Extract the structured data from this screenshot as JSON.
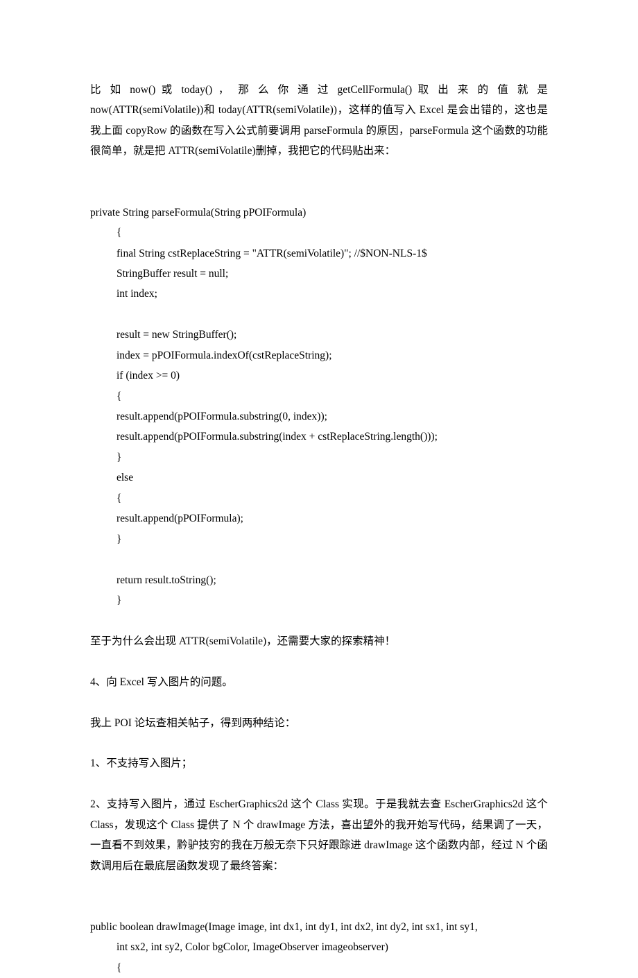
{
  "para_intro_1": "比 如 now()  或 today()  ， 那 么 你 通 过 getCellFormula()  取 出 来 的 值 就 是",
  "para_intro_rest": "now(ATTR(semiVolatile))和 today(ATTR(semiVolatile))，这样的值写入 Excel 是会出错的，这也是我上面 copyRow 的函数在写入公式前要调用 parseFormula 的原因，parseFormula 这个函数的功能很简单，就是把 ATTR(semiVolatile)删掉，我把它的代码贴出来：",
  "code1_head": "private String parseFormula(String pPOIFormula)",
  "code1_lines": [
    "{",
    "final String cstReplaceString = \"ATTR(semiVolatile)\"; //$NON-NLS-1$",
    "StringBuffer result = null;",
    "int index;",
    "",
    "result = new StringBuffer();",
    "index = pPOIFormula.indexOf(cstReplaceString);",
    "if (index >= 0)",
    "{",
    "result.append(pPOIFormula.substring(0, index));",
    "result.append(pPOIFormula.substring(index + cstReplaceString.length()));",
    "}",
    "else",
    "{",
    "result.append(pPOIFormula);",
    "}",
    "",
    "return result.toString();",
    "}"
  ],
  "para_attr": "至于为什么会出现 ATTR(semiVolatile)，还需要大家的探索精神！",
  "para_q4": "4、向 Excel 写入图片的问题。",
  "para_forum": "我上 POI 论坛查相关帖子，得到两种结论：",
  "para_opt1": "1、不支持写入图片；",
  "para_opt2": "2、支持写入图片，通过 EscherGraphics2d 这个 Class 实现。于是我就去查 EscherGraphics2d 这个 Class，发现这个 Class 提供了 N 个 drawImage 方法，喜出望外的我开始写代码，结果调了一天，一直看不到效果，黔驴技穷的我在万般无奈下只好跟踪进 drawImage 这个函数内部，经过 N 个函数调用后在最底层函数发现了最终答案：",
  "code2_head": "public boolean drawImage(Image image, int dx1, int dy1, int dx2, int dy2, int sx1, int sy1,",
  "code2_lines": [
    "int sx2, int sy2, Color bgColor, ImageObserver imageobserver)",
    "{"
  ]
}
